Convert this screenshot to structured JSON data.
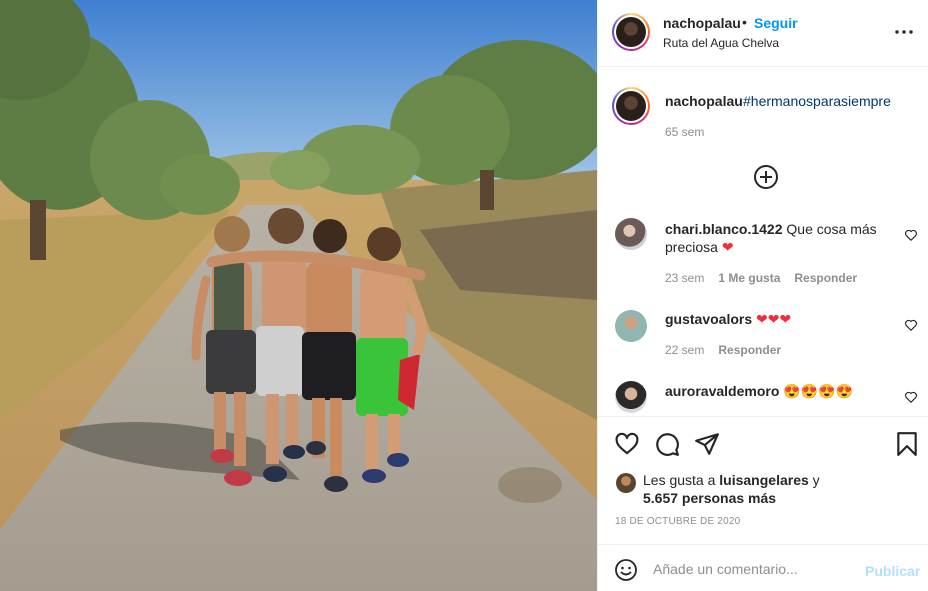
{
  "post": {
    "image_alt_icon": "photo-boys-walking",
    "header": {
      "username": "nachopalau",
      "separator": "•",
      "follow_label": "Seguir",
      "location": "Ruta del Agua Chelva"
    },
    "caption": {
      "username": "nachopalau",
      "hashtag": "#hermanosparasiempre",
      "time": "65 sem"
    },
    "comments": [
      {
        "username": "chari.blanco.1422",
        "text": "Que cosa más preciosa",
        "emoji": "❤",
        "time": "23 sem",
        "likes": "1 Me gusta",
        "reply_label": "Responder"
      },
      {
        "username": "gustavoalors",
        "text": "",
        "emoji": "❤❤❤",
        "time": "22 sem",
        "reply_label": "Responder"
      },
      {
        "username": "auroravaldemoro",
        "text": "",
        "emoji": "😍😍😍😍"
      }
    ],
    "likes": {
      "prefix": "Les gusta a",
      "user": "luisangelares",
      "suffix": "y",
      "others": "5.657 personas más"
    },
    "date": "18 DE OCTUBRE DE 2020",
    "comment_box": {
      "placeholder": "Añade un comentario...",
      "publish_label": "Publicar"
    }
  },
  "colors": {
    "accent": "#0095f6",
    "hashtag": "#00376b",
    "muted": "#8e8e8e",
    "publish_disabled": "#b2dffc",
    "heart": "#ed2f3c"
  }
}
